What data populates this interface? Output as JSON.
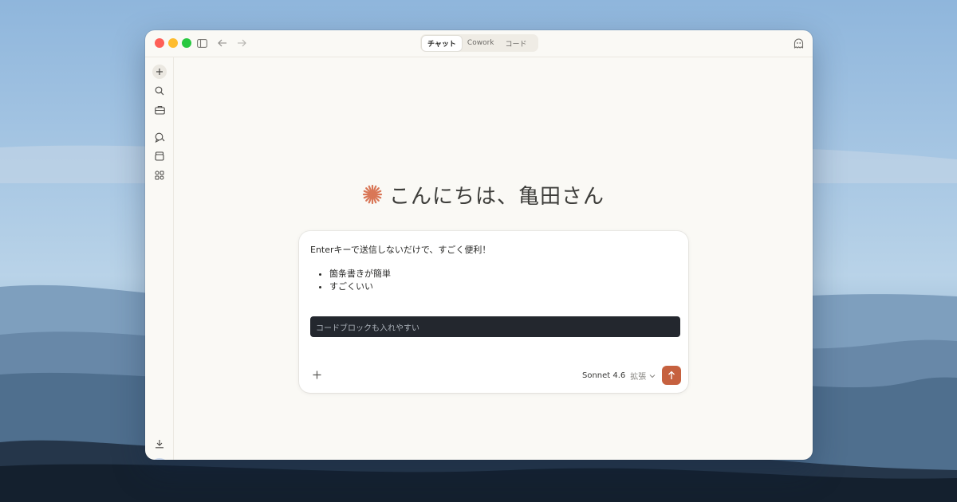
{
  "window": {
    "mode_tabs": [
      {
        "label": "チャット",
        "active": true
      },
      {
        "label": "Cowork",
        "active": false
      },
      {
        "label": "コード",
        "active": false
      }
    ]
  },
  "sidebar": {
    "icons": [
      "plus-icon",
      "search-icon",
      "briefcase-icon",
      "chat-bubbles-icon",
      "archive-icon",
      "apps-grid-icon",
      "download-icon"
    ]
  },
  "main": {
    "greeting": "こんにちは、亀田さん",
    "accent_color": "#d97757"
  },
  "composer": {
    "line1": "Enterキーで送信しないだけで、すごく便利！",
    "bullets": [
      "箇条書きが簡単",
      "すごくいい"
    ],
    "code_block": "コードブロックも入れやすい",
    "model_name": "Sonnet 4.6",
    "model_mode": "拡張",
    "send_color": "#c6613f"
  }
}
